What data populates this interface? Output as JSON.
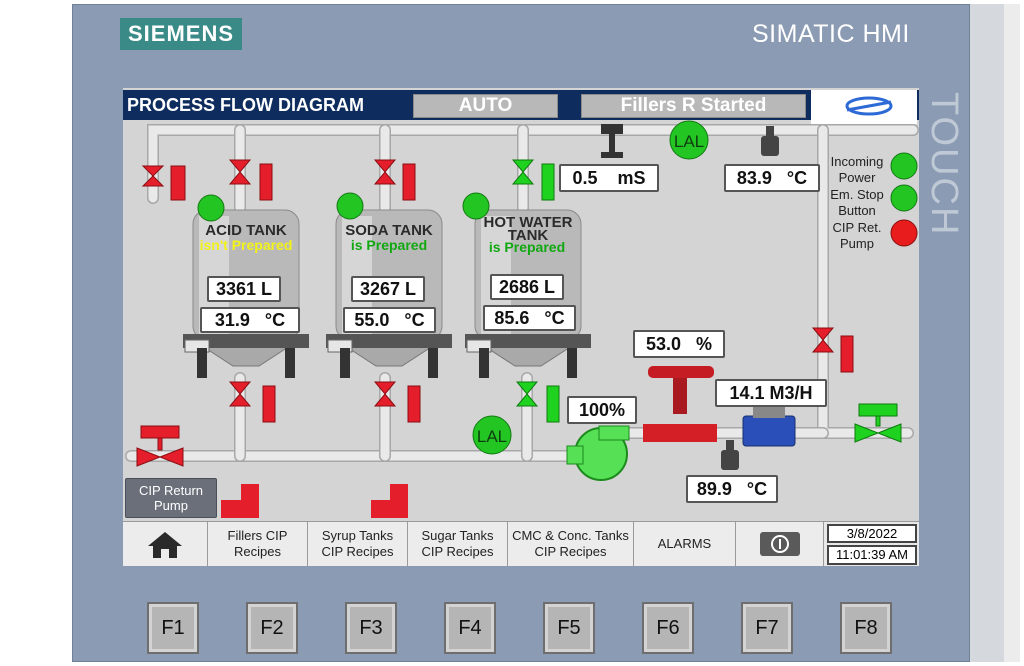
{
  "brand": {
    "logo": "SIEMENS",
    "product": "SIMATIC HMI",
    "touch": "TOUCH"
  },
  "header": {
    "title": "PROCESS FLOW DIAGRAM",
    "mode": "AUTO",
    "status": "Fillers R Started"
  },
  "tanks": [
    {
      "name": "ACID TANK",
      "status": "isn't Prepared",
      "status_color": "#f2f21a",
      "level": "3361 L",
      "temp_value": "31.9",
      "temp_unit": "°C"
    },
    {
      "name": "SODA TANK",
      "status": "is Prepared",
      "status_color": "#12a812",
      "level": "3267 L",
      "temp_value": "55.0",
      "temp_unit": "°C"
    },
    {
      "name_line1": "HOT WATER",
      "name_line2": "TANK",
      "status": "is Prepared",
      "status_color": "#12a812",
      "level": "2686 L",
      "temp_value": "85.6",
      "temp_unit": "°C"
    }
  ],
  "instruments": {
    "conductivity": {
      "value": "0.5",
      "unit": "mS"
    },
    "return_temp": {
      "value": "83.9",
      "unit": "°C"
    },
    "valve_position": {
      "value": "53.0",
      "unit": "%"
    },
    "pump_speed": "100%",
    "flow": {
      "value": "14.1",
      "unit": "M3/H"
    },
    "supply_temp": {
      "value": "89.9",
      "unit": "°C"
    },
    "lal_label": "LAL"
  },
  "legend": [
    {
      "label_line1": "Incoming",
      "label_line2": "Power",
      "color": "#22c522"
    },
    {
      "label_line1": "Em. Stop",
      "label_line2": "Button",
      "color": "#22c522"
    },
    {
      "label_line1": "CIP Ret.",
      "label_line2": "Pump",
      "color": "#e81c1c"
    }
  ],
  "cip_return_button": {
    "line1": "CIP Return",
    "line2": "Pump"
  },
  "nav": {
    "home_icon": "home-icon",
    "items": [
      {
        "line1": "Fillers CIP",
        "line2": "Recipes"
      },
      {
        "line1": "Syrup Tanks",
        "line2": "CIP Recipes"
      },
      {
        "line1": "Sugar Tanks",
        "line2": "CIP Recipes"
      },
      {
        "line1": "CMC & Conc. Tanks",
        "line2": "CIP Recipes"
      },
      {
        "line1": "ALARMS"
      }
    ],
    "info_icon": "info-icon",
    "date": "3/8/2022",
    "time": "11:01:39 AM"
  },
  "fkeys": [
    "F1",
    "F2",
    "F3",
    "F4",
    "F5",
    "F6",
    "F7",
    "F8"
  ],
  "colors": {
    "pipe": "#e9e9e9",
    "valve_red": "#e41e2a",
    "valve_green": "#1fd21f",
    "indicator_green": "#22c522",
    "title_bg": "#0e2d5e"
  }
}
